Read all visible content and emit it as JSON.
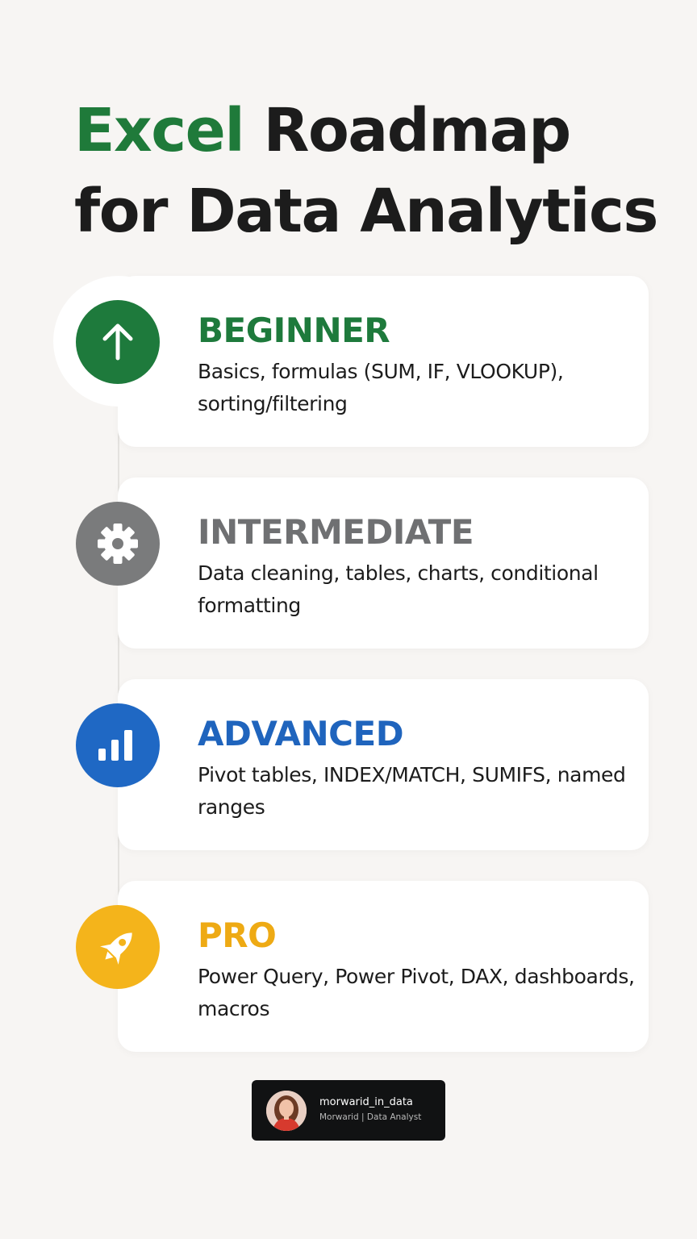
{
  "title": {
    "accent": "Excel",
    "rest_line1": " Roadmap",
    "line2": "for Data Analytics"
  },
  "colors": {
    "background": "#f7f5f3",
    "beginner": "#1e7a3c",
    "intermediate": "#7a7b7c",
    "advanced": "#1f68c4",
    "pro": "#f4b41b"
  },
  "levels": [
    {
      "title": "BEGINNER",
      "icon": "arrow-up-icon",
      "description": "Basics, formulas (SUM, IF, VLOOKUP), sorting/filtering"
    },
    {
      "title": "INTERMEDIATE",
      "icon": "gear-icon",
      "description": "Data cleaning, tables, charts, conditional formatting"
    },
    {
      "title": "ADVANCED",
      "icon": "bar-chart-icon",
      "description": "Pivot tables, INDEX/MATCH, SUMIFS, named ranges"
    },
    {
      "title": "PRO",
      "icon": "rocket-icon",
      "description": "Power Query, Power Pivot, DAX, dashboards, macros"
    }
  ],
  "credit": {
    "handle": "morwarid_in_data",
    "subtitle": "Morwarid | Data Analyst"
  }
}
